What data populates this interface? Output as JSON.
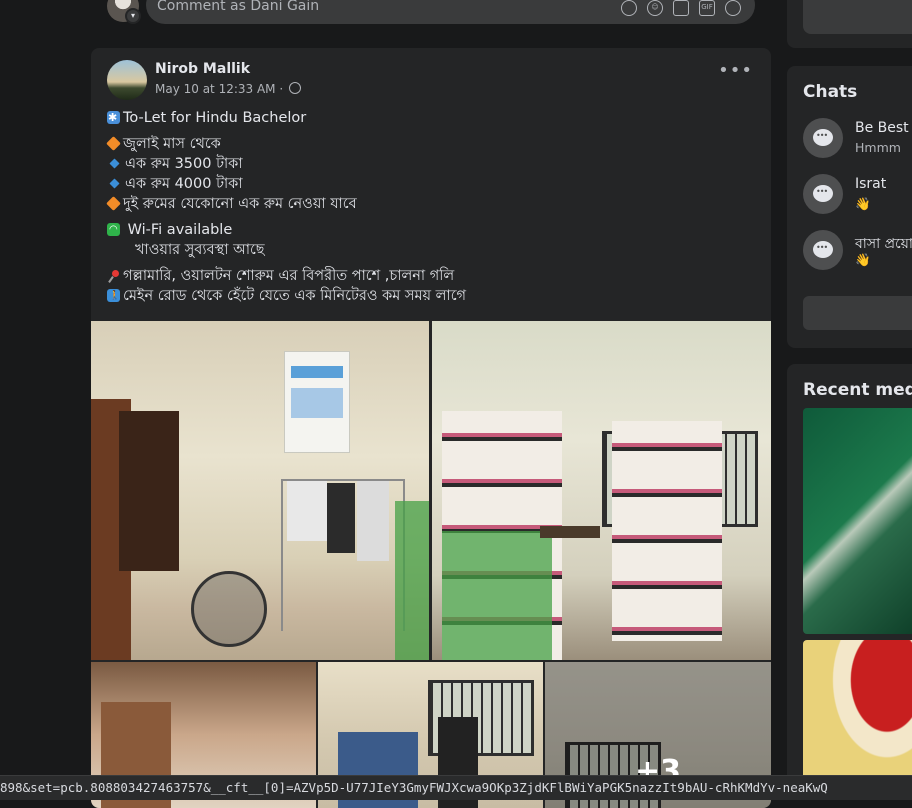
{
  "comment_box": {
    "placeholder": "Comment as Dani Gain",
    "icons": [
      "sticker-icon",
      "emoji-icon",
      "camera-icon",
      "gif-icon",
      "avatar-sticker-icon"
    ]
  },
  "post": {
    "author": "Nirob Mallik",
    "timestamp": "May 10 at 12:33 AM ·",
    "privacy_icon": "globe-icon",
    "more_label": "•••",
    "lines": {
      "title": "To-Let for Hindu Bachelor",
      "l1": "জুলাই মাস থেকে",
      "l2": "এক রুম 3500 টাকা",
      "l3": "এক রুম 4000 টাকা",
      "l4": "দুই রুমের যেকোনো এক রুম নেওয়া যাবে",
      "wifi": "Wi-Fi available",
      "food": "খাওয়ার সুব্যবস্থা আছে",
      "location": "গল্লামারি, ওয়ালটন শোরুম এর বিপরীত পাশে ,চালনা গলি",
      "walk": "মেইন রোড থেকে হেঁটে যেতে এক মিনিটেরও কম সময় লাগে"
    },
    "photos_more_count": "+3"
  },
  "chats": {
    "title": "Chats",
    "items": [
      {
        "name": "Be Best",
        "message": "Hmmm"
      },
      {
        "name": "Israt",
        "message": "👋"
      },
      {
        "name": "বাসা প্রয়ো",
        "message": "👋"
      }
    ]
  },
  "recent_media": {
    "title": "Recent media"
  },
  "status_url": "898&set=pcb.808803427463757&__cft__[0]=AZVp5D-U77JIeY3GmyFWJXcwa9OKp3ZjdKFlBWiYaPGK5nazzIt9bAU-cRhKMdYv-neaKwQ"
}
